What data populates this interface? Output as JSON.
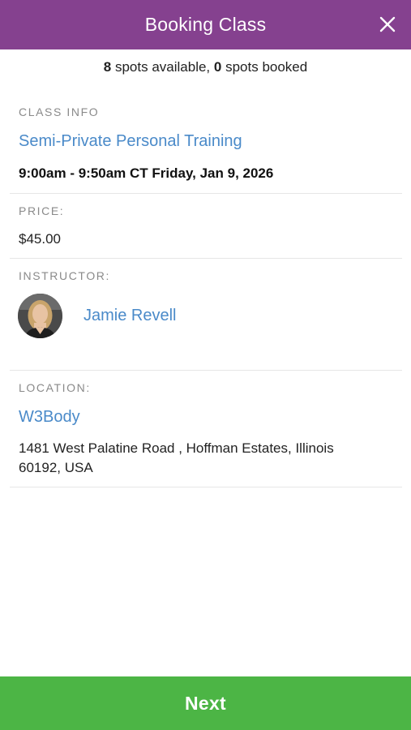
{
  "header": {
    "title": "Booking Class",
    "close_icon": "close-icon",
    "color": "#85418f"
  },
  "availability": {
    "spots_available_count": "8",
    "spots_available_text": " spots available, ",
    "spots_booked_count": "0",
    "spots_booked_text": " spots booked"
  },
  "class_info": {
    "label": "CLASS INFO",
    "name": "Semi-Private Personal Training",
    "time": "9:00am - 9:50am CT Friday, Jan 9, 2026"
  },
  "price": {
    "label": "PRICE:",
    "value": "$45.00"
  },
  "instructor": {
    "label": "INSTRUCTOR:",
    "name": "Jamie Revell",
    "avatar_icon": "instructor-avatar"
  },
  "location": {
    "label": "LOCATION:",
    "name": "W3Body",
    "address": "1481 West Palatine Road , Hoffman Estates, Illinois 60192, USA"
  },
  "footer": {
    "next_label": "Next",
    "color": "#4cb545"
  },
  "colors": {
    "link": "#4a8ac9",
    "label": "#8a8a8a",
    "divider": "#e6e6e6"
  }
}
